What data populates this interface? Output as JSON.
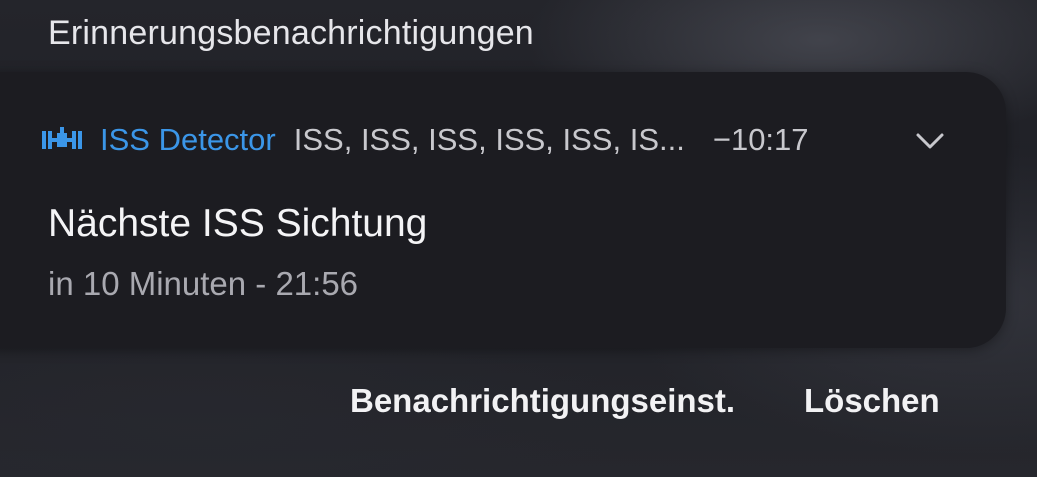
{
  "section": {
    "title": "Erinnerungsbenachrichtigungen"
  },
  "notification": {
    "app_icon": "satellite-icon",
    "app_name": "ISS Detector",
    "summary": "ISS, ISS, ISS, ISS, ISS, IS...",
    "time": "−10:17",
    "title": "Nächste ISS Sichtung",
    "text": "in 10 Minuten - 21:56",
    "expand_icon": "chevron-down-icon"
  },
  "actions": {
    "settings_label": "Benachrichtigungseinst.",
    "delete_label": "Löschen"
  },
  "colors": {
    "accent": "#3b96e8",
    "card_background": "#1c1c21"
  }
}
